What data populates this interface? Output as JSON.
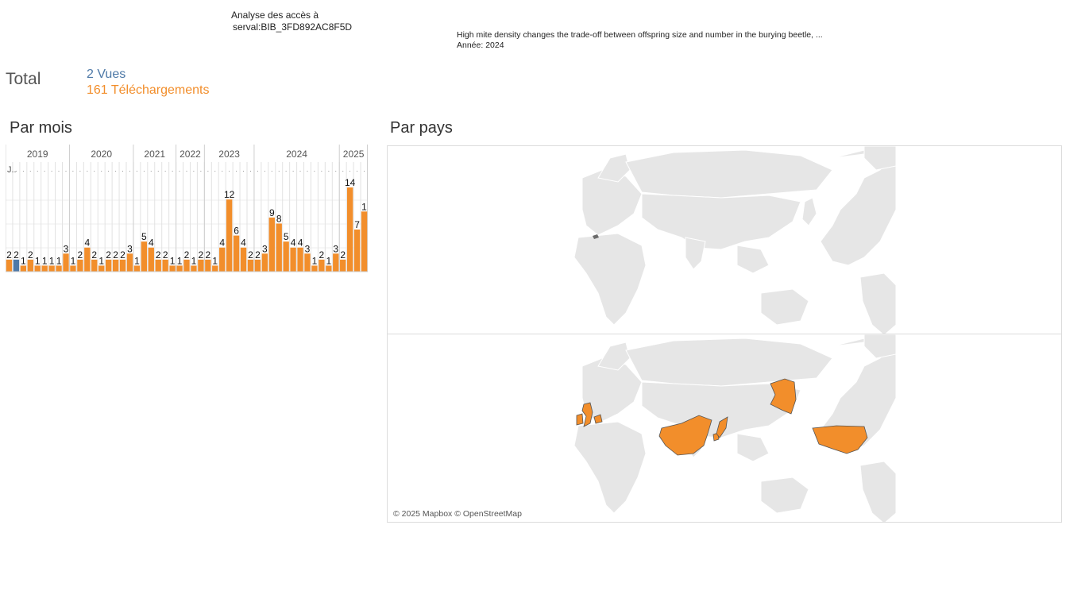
{
  "header": {
    "title_line1": "Analyse des accès à",
    "title_line2": "serval:BIB_3FD892AC8F5D",
    "pub_title": "High mite density changes the trade-off between offspring size and number in the burying beetle, ...",
    "pub_year": "Année: 2024"
  },
  "totals": {
    "label": "Total",
    "views": "2 Vues",
    "downloads": "161 Téléchargements"
  },
  "colors": {
    "views": "#4e79a7",
    "downloads": "#f28e2b",
    "land": "#e6e6e6",
    "land_border": "#ffffff",
    "highlight_border": "#555555",
    "gray_point": "#6b6b6b"
  },
  "sections": {
    "monthly": "Par mois",
    "countries": "Par pays"
  },
  "map": {
    "attribution": "© 2025 Mapbox © OpenStreetMap",
    "top_panel_highlighted_countries": [
      "Switzerland"
    ],
    "bottom_panel_highlighted_countries": [
      "United Kingdom",
      "Ireland",
      "Netherlands",
      "China",
      "Japan",
      "South Korea",
      "United States"
    ]
  },
  "chart_data": {
    "type": "bar",
    "title": "Par mois",
    "xlabel": "",
    "ylabel": "",
    "ylim": [
      0,
      14
    ],
    "grid": true,
    "month_header_label": "J..",
    "year_groups": [
      {
        "year": "2019",
        "months": 9
      },
      {
        "year": "2020",
        "months": 9
      },
      {
        "year": "2021",
        "months": 6
      },
      {
        "year": "2022",
        "months": 4
      },
      {
        "year": "2023",
        "months": 7
      },
      {
        "year": "2024",
        "months": 12
      },
      {
        "year": "2025",
        "months": 4
      }
    ],
    "series": [
      {
        "name": "Vues",
        "values": [
          0,
          2,
          0,
          0,
          0,
          0,
          0,
          0,
          0,
          0,
          0,
          0,
          0,
          0,
          0,
          0,
          0,
          0,
          0,
          0,
          0,
          0,
          0,
          0,
          0,
          0,
          0,
          0,
          0,
          0,
          0,
          0,
          0,
          0,
          0,
          0,
          0,
          0,
          0,
          0,
          0,
          0,
          0,
          0,
          0,
          0,
          0,
          0,
          0,
          0,
          0
        ]
      },
      {
        "name": "Téléchargements",
        "values": [
          2,
          0,
          1,
          2,
          1,
          1,
          1,
          1,
          3,
          1,
          2,
          4,
          2,
          1,
          2,
          2,
          2,
          3,
          1,
          5,
          4,
          2,
          2,
          1,
          1,
          2,
          1,
          2,
          2,
          1,
          4,
          12,
          6,
          4,
          2,
          2,
          3,
          9,
          8,
          5,
          4,
          4,
          3,
          1,
          2,
          1,
          3,
          2,
          14,
          7,
          10
        ]
      }
    ],
    "labels": [
      "2",
      "2",
      "1",
      "2",
      "1",
      "1",
      "1",
      "1",
      "3",
      "1",
      "2",
      "4",
      "2",
      "1",
      "2",
      "2",
      "2",
      "3",
      "1",
      "5",
      "4",
      "2",
      "2",
      "1",
      "1",
      "2",
      "1",
      "2",
      "2",
      "1",
      "4",
      "12",
      "6",
      "4",
      "2",
      "2",
      "3",
      "9",
      "8",
      "5",
      "4",
      "4",
      "3",
      "1",
      "2",
      "1",
      "3",
      "2",
      "14",
      "7",
      "1"
    ]
  }
}
